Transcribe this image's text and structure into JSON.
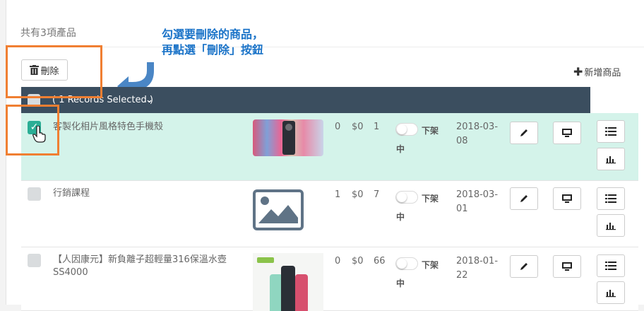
{
  "header": {
    "count_text": "共有3項產品"
  },
  "callout": {
    "line1": "勾選要刪除的商品，",
    "line2": "再點選「刪除」按鈕"
  },
  "toolbar": {
    "delete_label": "刪除",
    "add_label": "新增商品"
  },
  "selection_bar": {
    "text": "( 1 Records Selected )"
  },
  "rows": [
    {
      "checked": true,
      "name": "客製化相片風格特色手機殼",
      "image": "phone-case-photo",
      "stock": "0",
      "price": "$0",
      "views": "1",
      "status_line1": "下架",
      "status_line2": "中",
      "date_line1": "2018-03-",
      "date_line2": "08"
    },
    {
      "checked": false,
      "name": "行銷課程",
      "image": "image-placeholder-icon",
      "stock": "1",
      "price": "$0",
      "views": "7",
      "status_line1": "下架",
      "status_line2": "中",
      "date_line1": "2018-03-",
      "date_line2": "01"
    },
    {
      "checked": false,
      "name": "【人因康元】新負離子超輕量316保溫水壺SS4000",
      "image": "thermos-bottles-photo",
      "stock": "0",
      "price": "$0",
      "views": "66",
      "status_line1": "下架",
      "status_line2": "中",
      "date_line1": "2018-01-",
      "date_line2": "22"
    }
  ],
  "colors": {
    "accent": "#2aae95",
    "selected_row": "#d4f3ea",
    "header_bar": "#3b4e5f",
    "highlight": "#f07f32",
    "callout_text": "#1a73c8",
    "callout_arrow": "#4a86c5"
  }
}
